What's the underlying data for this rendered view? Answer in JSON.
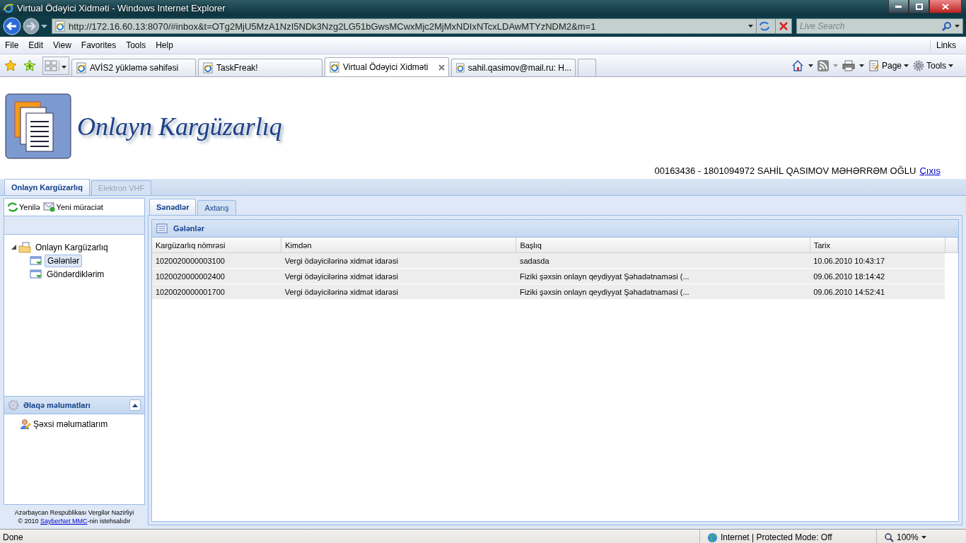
{
  "window": {
    "title": "Virtual Ödəyici Xidməti - Windows Internet Explorer"
  },
  "address_bar": {
    "url": "http://172.16.60.13:8070/#inbox&t=OTg2MjU5MzA1NzI5NDk3Nzg2LG51bGwsMCwxMjc2MjMxNDIxNTcxLDAwMTYzNDM2&m=1",
    "search_placeholder": "Live Search"
  },
  "menu": [
    "File",
    "Edit",
    "View",
    "Favorites",
    "Tools",
    "Help"
  ],
  "links_label": "Links",
  "browser_tabs": [
    {
      "title": "AVİS2 yükləmə səhifəsi",
      "selected": false
    },
    {
      "title": "TaskFreak!",
      "selected": false
    },
    {
      "title": "Virtual Ödəyici Xidməti",
      "selected": true
    },
    {
      "title": "sahil.qasimov@mail.ru: H...",
      "selected": false
    }
  ],
  "command_bar": [
    "Page",
    "Tools"
  ],
  "page": {
    "logo_title": "Onlayn Kargüzarlıq",
    "user_info": "00163436 - 1801094972 SAHİL QASIMOV MƏHƏRRƏM OĞLU",
    "logout_link": "Çıxış",
    "app_tabs": [
      {
        "label": "Onlayn Kargüzarlıq",
        "selected": true,
        "disabled": false
      },
      {
        "label": "Elektron VHF",
        "selected": false,
        "disabled": true
      }
    ],
    "toolbar": [
      "Yenilə",
      "Yeni müraciət"
    ],
    "tree": [
      {
        "label": "Onlayn Kargüzarlıq",
        "selected": false,
        "expanded": true,
        "children": [
          {
            "label": "Gələnlər",
            "selected": true
          },
          {
            "label": "Göndərdiklərim",
            "selected": false
          }
        ]
      }
    ],
    "contact_panel": {
      "title": "Əlaqə məlumatları",
      "expanded": true,
      "items": [
        "Şəxsi məlumatlarım"
      ]
    },
    "footer": {
      "text": "Azərbaycan Respublikası Vergilər Nazirliyi",
      "prefix": "© 2010 ",
      "link": "SayberNet MMC",
      "suffix": "-nin istehsalıdır"
    },
    "content_tabs": [
      {
        "label": "Sənədlər",
        "selected": true
      },
      {
        "label": "Axtarış",
        "selected": false
      }
    ],
    "grid": {
      "title": "Gələnlər",
      "columns": [
        "Kargüzarlıq nömrəsi",
        "Kimdən",
        "Başlıq",
        "Tarix"
      ],
      "rows": [
        [
          "1020020000003100",
          "Vergi ödəyicilərinə xidmət idarəsi",
          "sadasda",
          "10.06.2010 10:43:17"
        ],
        [
          "1020020000002400",
          "Vergi ödəyicilərinə xidmət idarəsi",
          "Fiziki şəxsin onlayn qeydiyyat Şəhadətnaməsi (...",
          "09.06.2010 18:14:42"
        ],
        [
          "1020020000001700",
          "Vergi ödəyicilərinə xidmət idarəsi",
          "Fiziki şəxsin onlayn qeydiyyat Şəhadətnaməsi (...",
          "09.06.2010 14:52:41"
        ]
      ]
    }
  },
  "status_bar": {
    "text": "Done",
    "zone": "Internet | Protected Mode: Off",
    "zoom": "100%"
  }
}
